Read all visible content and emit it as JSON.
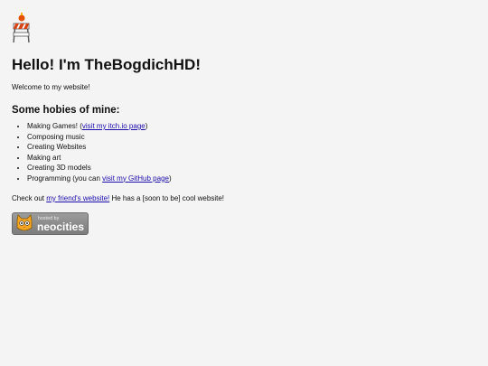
{
  "header": {
    "title": "Hello! I'm TheBogdichHD!",
    "welcome": "Welcome to my website!"
  },
  "hobbies": {
    "heading": "Some hobies of mine:",
    "items": [
      {
        "text": "Making Games! (",
        "link": "visit my itch.io page",
        "after": ")"
      },
      {
        "text": "Composing music"
      },
      {
        "text": "Creating Websites"
      },
      {
        "text": "Making art"
      },
      {
        "text": "Creating 3D models"
      },
      {
        "text": "Programming (you can ",
        "link": "visit my GitHub page",
        "after": ")"
      }
    ]
  },
  "footer": {
    "checkout_pre": "Check out ",
    "friend_link": "my friend's website!",
    "checkout_post": " He has a [soon to be] cool website!"
  },
  "badge": {
    "hosted_by": "hosted by",
    "name": "neocities"
  },
  "colors": {
    "link": "#1a0dab",
    "background": "#f4f4f4"
  },
  "icons": {
    "construction": "under-construction-barrier-icon",
    "badge": "neocities-cat-icon"
  }
}
